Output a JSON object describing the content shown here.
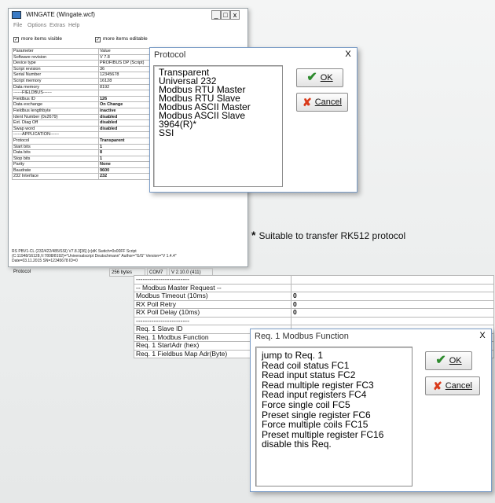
{
  "main_window": {
    "title": "WINGATE (Wingate.wcf)",
    "menu": [
      "File",
      "Options",
      "Extras",
      "Help"
    ],
    "controls": {
      "minimize": "_",
      "maximize": "□",
      "close": "x"
    },
    "checkbox_more_visible": "more items visible",
    "checkbox_more_editable": "more items editable",
    "params": [
      {
        "name": "Parameter",
        "value": "Value"
      },
      {
        "name": "Software revision",
        "value": "V 7.8"
      },
      {
        "name": "Device type",
        "value": "PROFIBUS DP (Script)"
      },
      {
        "name": "Script revision",
        "value": "36"
      },
      {
        "name": "Serial Number",
        "value": "12345678"
      },
      {
        "name": "Script memory",
        "value": "16128"
      },
      {
        "name": "Data memory",
        "value": "8192"
      },
      {
        "name": "------FIELDBUS------",
        "value": ""
      },
      {
        "name": "Fieldbus ID",
        "value": "126",
        "bold": true
      },
      {
        "name": "Data exchange",
        "value": "On Change",
        "bold": true
      },
      {
        "name": "Fieldbus lengthbyte",
        "value": "inactive",
        "bold": true
      },
      {
        "name": "Ident Number (0x2679)",
        "value": "disabled",
        "bold": true
      },
      {
        "name": "Ext. Diag Off",
        "value": "disabled",
        "bold": true
      },
      {
        "name": "Swap word",
        "value": "disabled",
        "bold": true
      },
      {
        "name": "------APPLICATION------",
        "value": ""
      },
      {
        "name": "Protocol",
        "value": "Transparent",
        "bold": true
      },
      {
        "name": "Start bits",
        "value": "1",
        "bold": true
      },
      {
        "name": "Data bits",
        "value": "8",
        "bold": true
      },
      {
        "name": "Stop bits",
        "value": "1",
        "bold": true
      },
      {
        "name": "Parity",
        "value": "None",
        "bold": true
      },
      {
        "name": "Baudrate",
        "value": "9600",
        "bold": true
      },
      {
        "name": "232 Interface",
        "value": "232",
        "bold": true
      }
    ],
    "info_line1": "RS PBV1-CL (232/422/485/SSI) V7.8.3[36] (c)dK Switch=0x00FF Script",
    "info_line2": "(C:11948/16128,V:7808/8192)=\"Universalscript Deutschmann\" Author=\"G/S\" Version=\"V 1.4.4\"",
    "info_line3": "Date=03.11.2015 SN=12345678 ID=0",
    "status": {
      "field": "Protocol",
      "bytes": "256 bytes",
      "port": "COM7",
      "version": "V 2.10.0 (411)"
    }
  },
  "protocol_dialog": {
    "title": "Protocol",
    "close": "X",
    "options": [
      "Transparent",
      "Universal 232",
      "Modbus RTU Master",
      "Modbus RTU Slave",
      "Modbus ASCII Master",
      "Modbus ASCII Slave",
      "3964(R)*",
      "SSI"
    ],
    "ok_label": "OK",
    "cancel_label": "Cancel"
  },
  "footnote": {
    "star": "*",
    "text": "Suitable to transfer RK512 protocol"
  },
  "modbus_table": {
    "rows": [
      {
        "name": "------------------------",
        "value": ""
      },
      {
        "name": "-- Modbus Master Request --",
        "value": ""
      },
      {
        "name": "Modbus Timeout (10ms)",
        "value": "0"
      },
      {
        "name": "RX Poll Retry",
        "value": "0"
      },
      {
        "name": "RX Poll Delay (10ms)",
        "value": "0"
      },
      {
        "name": "------------------------",
        "value": ""
      },
      {
        "name": "Req. 1 Slave ID",
        "value": ""
      },
      {
        "name": "Req. 1 Modbus Function",
        "value": ""
      },
      {
        "name": "Req. 1 StartAdr (hex)",
        "value": ""
      },
      {
        "name": "Req. 1 Fieldbus Map Adr(Byte)",
        "value": ""
      }
    ]
  },
  "modbus_dialog": {
    "title": "Req. 1 Modbus Function",
    "close": "X",
    "options": [
      "jump to Req. 1",
      "Read coil status FC1",
      "Read input status FC2",
      "Read multiple register FC3",
      "Read input registers FC4",
      "Force single coil FC5",
      "Preset single register FC6",
      "Force multiple coils FC15",
      "Preset multiple register FC16",
      "disable this Req."
    ],
    "ok_label": "OK",
    "cancel_label": "Cancel"
  }
}
